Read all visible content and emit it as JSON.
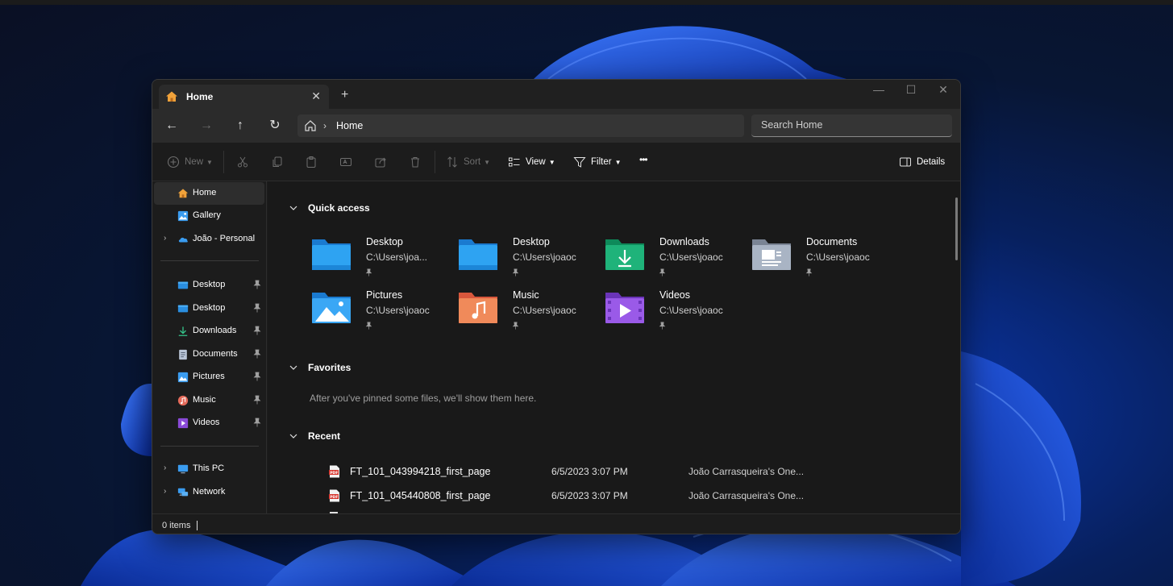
{
  "window": {
    "tab_title": "Home",
    "tab_close": "✕",
    "new_tab": "+",
    "minimize": "—",
    "maximize": "☐",
    "close": "✕"
  },
  "nav": {
    "back": "←",
    "forward": "→",
    "up": "↑",
    "refresh": "↻",
    "breadcrumb": "Home",
    "separator": "›",
    "search_placeholder": "Search Home"
  },
  "toolbar": {
    "new_label": "New",
    "sort_label": "Sort",
    "view_label": "View",
    "filter_label": "Filter",
    "more_label": "•••",
    "details_label": "Details"
  },
  "sidebar": {
    "top_items": [
      {
        "label": "Home",
        "icon": "home-icon"
      },
      {
        "label": "Gallery",
        "icon": "gallery-icon"
      },
      {
        "label": "João - Personal",
        "icon": "onedrive-icon"
      }
    ],
    "pinned": [
      {
        "label": "Desktop",
        "icon": "desktop-folder-icon"
      },
      {
        "label": "Desktop",
        "icon": "desktop-folder-icon"
      },
      {
        "label": "Downloads",
        "icon": "downloads-icon"
      },
      {
        "label": "Documents",
        "icon": "documents-icon"
      },
      {
        "label": "Pictures",
        "icon": "pictures-icon"
      },
      {
        "label": "Music",
        "icon": "music-icon"
      },
      {
        "label": "Videos",
        "icon": "videos-icon"
      }
    ],
    "bottom_items": [
      {
        "label": "This PC",
        "icon": "pc-icon"
      },
      {
        "label": "Network",
        "icon": "network-icon"
      }
    ]
  },
  "main": {
    "quick_access": {
      "heading": "Quick access",
      "items": [
        {
          "name": "Desktop",
          "path": "C:\\Users\\joa...",
          "icon": "desktop-folder-icon"
        },
        {
          "name": "Desktop",
          "path": "C:\\Users\\joaoc",
          "icon": "desktop-folder-icon"
        },
        {
          "name": "Downloads",
          "path": "C:\\Users\\joaoc",
          "icon": "downloads-folder-icon"
        },
        {
          "name": "Documents",
          "path": "C:\\Users\\joaoc",
          "icon": "documents-folder-icon"
        },
        {
          "name": "Pictures",
          "path": "C:\\Users\\joaoc",
          "icon": "pictures-folder-icon"
        },
        {
          "name": "Music",
          "path": "C:\\Users\\joaoc",
          "icon": "music-folder-icon"
        },
        {
          "name": "Videos",
          "path": "C:\\Users\\joaoc",
          "icon": "videos-folder-icon"
        }
      ]
    },
    "favorites": {
      "heading": "Favorites",
      "empty_text": "After you've pinned some files, we'll show them here."
    },
    "recent": {
      "heading": "Recent",
      "files": [
        {
          "name": "FT_101_043994218_first_page",
          "date": "6/5/2023 3:07 PM",
          "location": "João Carrasqueira's One..."
        },
        {
          "name": "FT_101_045440808_first_page",
          "date": "6/5/2023 3:07 PM",
          "location": "João Carrasqueira's One..."
        }
      ]
    }
  },
  "status": {
    "item_count": "0 items"
  },
  "colors": {
    "window_bg": "#1c1c1c",
    "nav_bg": "#2b2b2b",
    "accent_blue": "#1e90e0",
    "wallpaper_blue": "#0c3ab8"
  }
}
